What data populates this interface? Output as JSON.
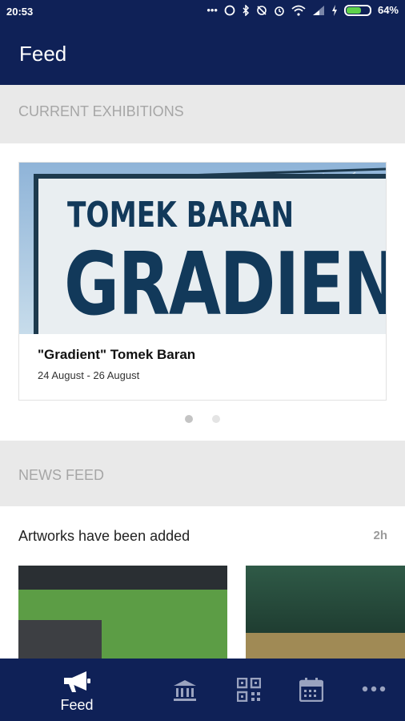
{
  "status_bar": {
    "time": "20:53",
    "battery_percent": "64%",
    "battery_level": 0.64
  },
  "app_bar": {
    "title": "Feed"
  },
  "current_exhibitions": {
    "header": "CURRENT EXHIBITIONS",
    "card": {
      "image_text_line1": "TOMEK BARAN",
      "image_text_line2": "GRADIEN",
      "title": "\"Gradient\" Tomek Baran",
      "dates": "24 August  - 26 August"
    },
    "pager": {
      "pages": 2,
      "active_index": 0
    }
  },
  "news_feed": {
    "header": "NEWS FEED",
    "item": {
      "title": "Artworks have been added",
      "time": "2h"
    }
  },
  "bottom_nav": {
    "items": [
      {
        "label": "Feed",
        "icon": "megaphone-icon",
        "active": true
      },
      {
        "label": "",
        "icon": "museum-icon",
        "active": false
      },
      {
        "label": "",
        "icon": "qr-code-icon",
        "active": false
      },
      {
        "label": "",
        "icon": "calendar-icon",
        "active": false
      },
      {
        "label": "",
        "icon": "more-icon",
        "active": false
      }
    ]
  },
  "colors": {
    "primary": "#0f2157",
    "section_bg": "#e9e9e9",
    "section_text": "#a6a6a6",
    "dot_active": "#c4c4c4",
    "dot_inactive": "#e4e4e4"
  }
}
